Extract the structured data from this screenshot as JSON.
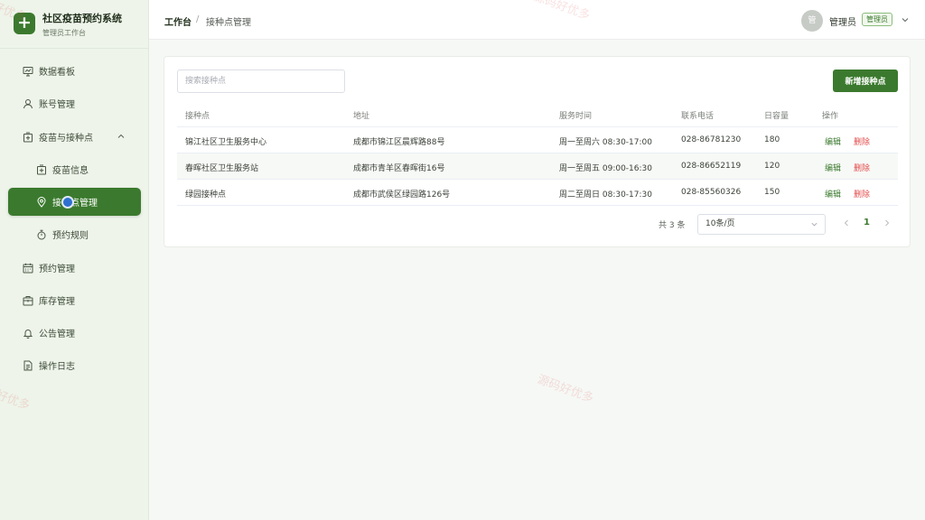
{
  "app": {
    "title": "社区疫苗预约系统",
    "subtitle": "管理员工作台",
    "logo_glyph": "+",
    "accent_color": "#3b7a2e"
  },
  "sidebar": {
    "items": [
      {
        "label": "数据看板",
        "icon": "dashboard-icon"
      },
      {
        "label": "账号管理",
        "icon": "user-icon"
      },
      {
        "label": "疫苗与接种点",
        "icon": "vaccine-box-icon",
        "expanded": true
      },
      {
        "label": "疫苗信息",
        "icon": "vaccine-box-icon"
      },
      {
        "label": "接种点管理",
        "icon": "location-pin-icon",
        "active": true
      },
      {
        "label": "预约规则",
        "icon": "stopwatch-icon"
      },
      {
        "label": "预约管理",
        "icon": "calendar-icon"
      },
      {
        "label": "库存管理",
        "icon": "inventory-icon"
      },
      {
        "label": "公告管理",
        "icon": "bell-icon"
      },
      {
        "label": "操作日志",
        "icon": "document-icon"
      }
    ]
  },
  "header": {
    "breadcrumb_home": "工作台",
    "breadcrumb_sep": "/",
    "breadcrumb_current": "接种点管理",
    "avatar_text": "管",
    "user_name": "管理员",
    "role": "管理员"
  },
  "main": {
    "search_placeholder": "搜索接种点",
    "add_button": "新增接种点",
    "columns": [
      "接种点",
      "地址",
      "服务时间",
      "联系电话",
      "日容量",
      "操作"
    ],
    "rows": [
      {
        "name": "锦江社区卫生服务中心",
        "address": "成都市锦江区晨辉路88号",
        "hours": "周一至周六 08:30-17:00",
        "phone": "028-86781230",
        "capacity": "180"
      },
      {
        "name": "春晖社区卫生服务站",
        "address": "成都市青羊区春晖街16号",
        "hours": "周一至周五 09:00-16:30",
        "phone": "028-86652119",
        "capacity": "120"
      },
      {
        "name": "绿园接种点",
        "address": "成都市武侯区绿园路126号",
        "hours": "周二至周日 08:30-17:30",
        "phone": "028-85560326",
        "capacity": "150"
      }
    ],
    "edit_label": "编辑",
    "delete_label": "删除"
  },
  "pagination": {
    "total": "共 3 条",
    "page_size": "10条/页",
    "current_page": "1"
  },
  "watermark": "源码好优多"
}
